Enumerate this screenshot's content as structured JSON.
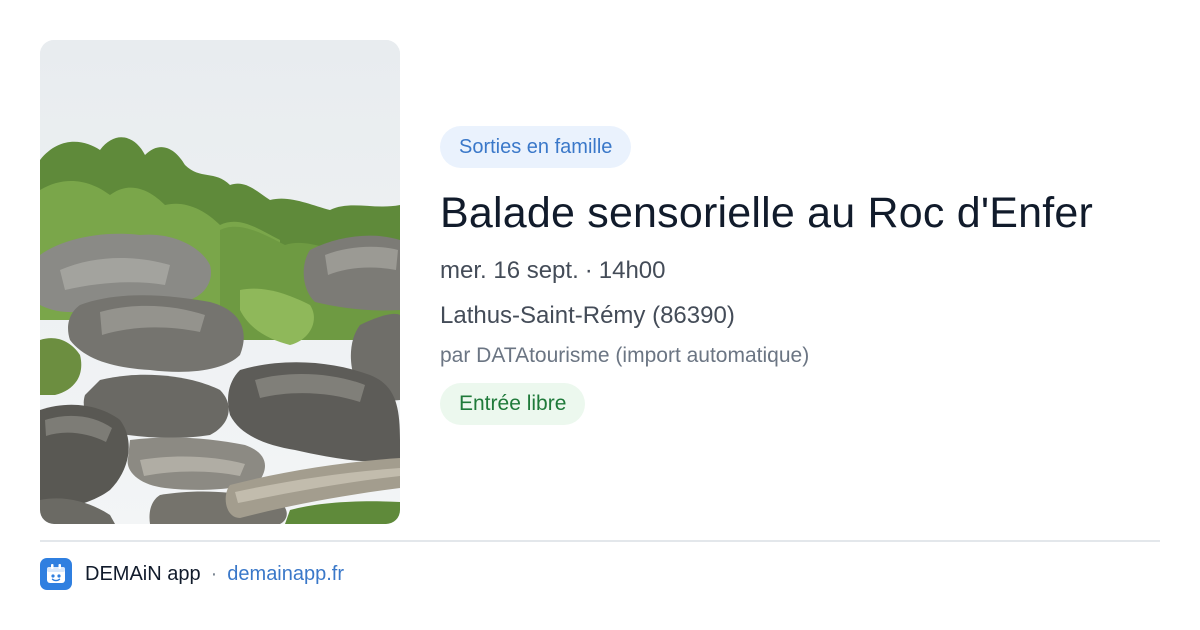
{
  "event": {
    "category": "Sorties en famille",
    "title": "Balade sensorielle au Roc d'Enfer",
    "date": "mer. 16 sept.",
    "separator": "·",
    "time": "14h00",
    "location": "Lathus-Saint-Rémy (86390)",
    "organizer": "par DATAtourisme (import automatique)",
    "price": "Entrée libre",
    "image_icon": "landscape-photo-rocks-forest"
  },
  "footer": {
    "app_name": "DEMAiN app",
    "separator": "·",
    "url": "demainapp.fr",
    "app_icon": "demain-app-icon"
  },
  "colors": {
    "category_bg": "#eaf2fd",
    "category_text": "#3a78c9",
    "price_bg": "#ecf8ee",
    "price_text": "#1f7a3a",
    "title_text": "#111b2b",
    "link": "#3a78c9",
    "app_icon_bg": "#2f7fe0"
  }
}
